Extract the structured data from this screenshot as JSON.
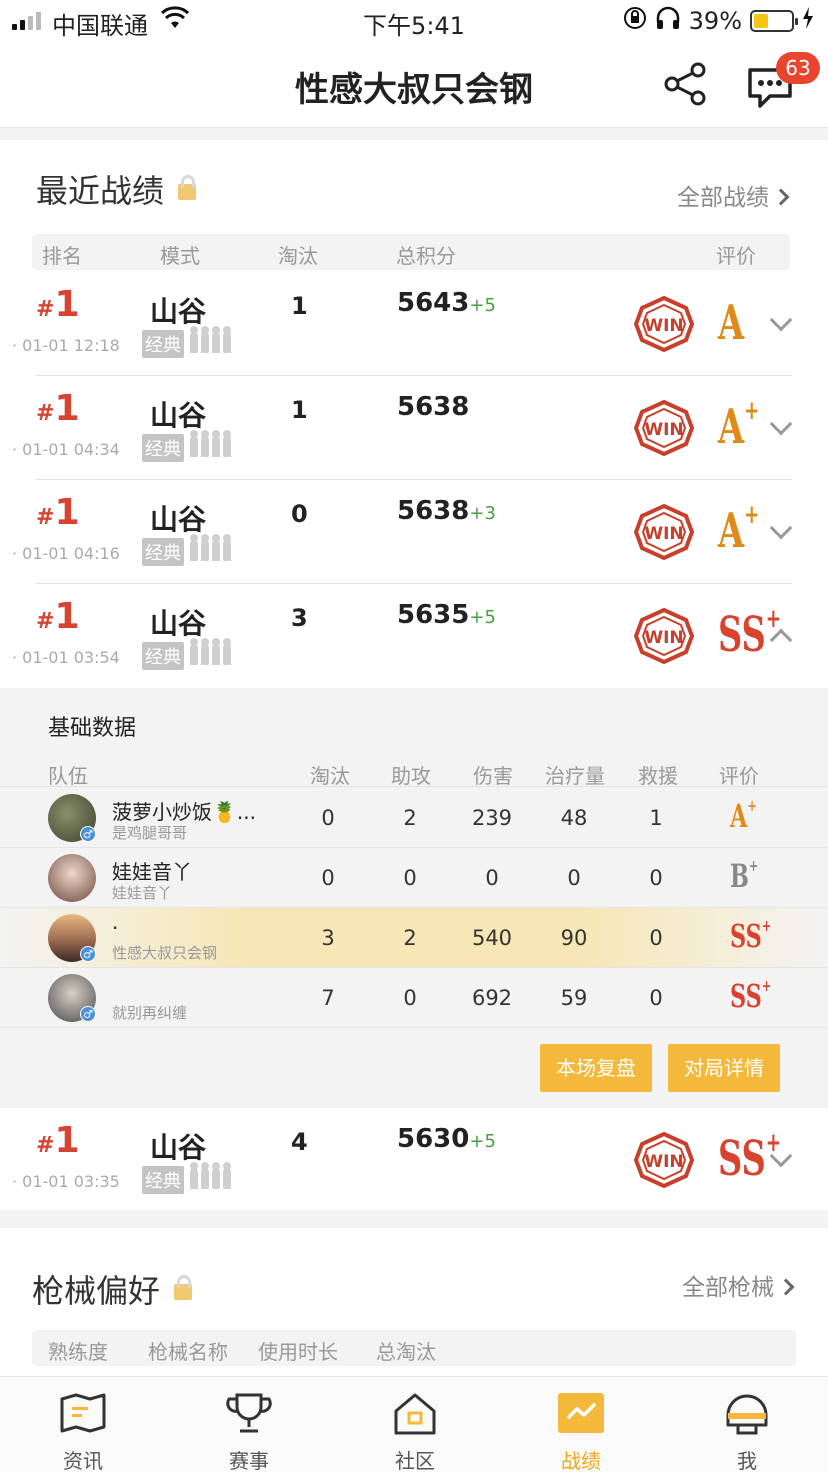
{
  "status_bar": {
    "carrier": "中国联通",
    "time": "下午5:41",
    "battery": "39%"
  },
  "nav": {
    "title": "性感大叔只会钢",
    "message_count": "63"
  },
  "recent": {
    "title": "最近战绩",
    "link": "全部战绩",
    "headers": [
      "排名",
      "模式",
      "淘汰",
      "总积分",
      "评价"
    ]
  },
  "matches": [
    {
      "hash": "#",
      "rank": "1",
      "time": "01-01 12:18",
      "map": "山谷",
      "mode": "经典",
      "kills": "1",
      "score": "5643",
      "delta": "+5",
      "grade": "A",
      "grade_plus": ""
    },
    {
      "hash": "#",
      "rank": "1",
      "time": "01-01 04:34",
      "map": "山谷",
      "mode": "经典",
      "kills": "1",
      "score": "5638",
      "delta": "",
      "grade": "A",
      "grade_plus": "+"
    },
    {
      "hash": "#",
      "rank": "1",
      "time": "01-01 04:16",
      "map": "山谷",
      "mode": "经典",
      "kills": "0",
      "score": "5638",
      "delta": "+3",
      "grade": "A",
      "grade_plus": "+"
    },
    {
      "hash": "#",
      "rank": "1",
      "time": "01-01 03:54",
      "map": "山谷",
      "mode": "经典",
      "kills": "3",
      "score": "5635",
      "delta": "+5",
      "grade": "SS",
      "grade_plus": "+"
    },
    {
      "hash": "#",
      "rank": "1",
      "time": "01-01 03:35",
      "map": "山谷",
      "mode": "经典",
      "kills": "4",
      "score": "5630",
      "delta": "+5",
      "grade": "SS",
      "grade_plus": "+"
    }
  ],
  "detail": {
    "title": "基础数据",
    "headers": [
      "队伍",
      "淘汰",
      "助攻",
      "伤害",
      "治疗量",
      "救援",
      "评价"
    ],
    "players": [
      {
        "name": "菠萝小炒饭🍍...",
        "sub": "是鸡腿哥哥",
        "kills": "0",
        "assists": "2",
        "damage": "239",
        "heal": "48",
        "rescue": "1",
        "grade": "A",
        "plus": "+"
      },
      {
        "name": "娃娃音丫",
        "sub": "娃娃音丫",
        "kills": "0",
        "assists": "0",
        "damage": "0",
        "heal": "0",
        "rescue": "0",
        "grade": "B",
        "plus": "+"
      },
      {
        "name": "·",
        "sub": "性感大叔只会钢",
        "kills": "3",
        "assists": "2",
        "damage": "540",
        "heal": "90",
        "rescue": "0",
        "grade": "SS",
        "plus": "+"
      },
      {
        "name": "",
        "sub": "就别再纠缠",
        "kills": "7",
        "assists": "0",
        "damage": "692",
        "heal": "59",
        "rescue": "0",
        "grade": "SS",
        "plus": "+"
      }
    ],
    "replay_label": "本场复盘",
    "details_label": "对局详情"
  },
  "weapons": {
    "title": "枪械偏好",
    "link": "全部枪械",
    "headers": [
      "熟练度",
      "枪械名称",
      "使用时长",
      "总淘汰"
    ]
  },
  "tabs": [
    {
      "label": "资讯"
    },
    {
      "label": "赛事"
    },
    {
      "label": "社区"
    },
    {
      "label": "战绩"
    },
    {
      "label": "我"
    }
  ],
  "colors": {
    "accent": "#f4b93a",
    "rank_red": "#d8432f",
    "grade_orange": "#e08a18",
    "delta_green": "#47a040"
  }
}
